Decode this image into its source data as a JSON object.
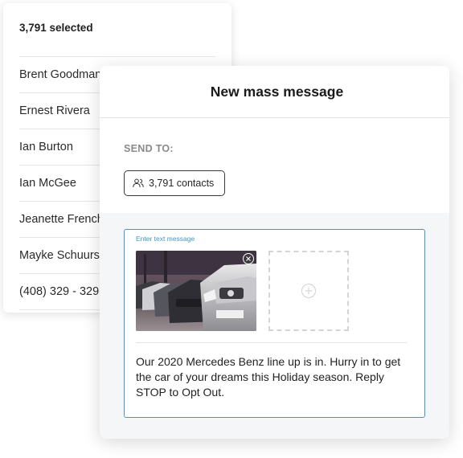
{
  "contacts_panel": {
    "selected_label": "3,791 selected",
    "rows": [
      "Brent Goodman",
      "Ernest Rivera",
      "Ian Burton",
      "Ian McGee",
      "Jeanette French",
      "Mayke Schuurs",
      "(408) 329 - 3291"
    ]
  },
  "modal": {
    "title": "New mass message",
    "send_to_label": "SEND TO:",
    "recipients": {
      "label": "3,791 contacts",
      "icon": "users-icon"
    },
    "compose": {
      "label": "Enter text message",
      "message": "Our 2020 Mercedes Benz line up is in. Hurry in to get the car of your dreams this Holiday season. Reply STOP to Opt Out.",
      "attachment": {
        "description_icon": "image-thumbnail",
        "remove_icon": "close-icon"
      },
      "add_icon": "plus-circle-icon"
    }
  },
  "colors": {
    "accent": "#3d97d3",
    "compose_background": "#f4f6f8"
  }
}
